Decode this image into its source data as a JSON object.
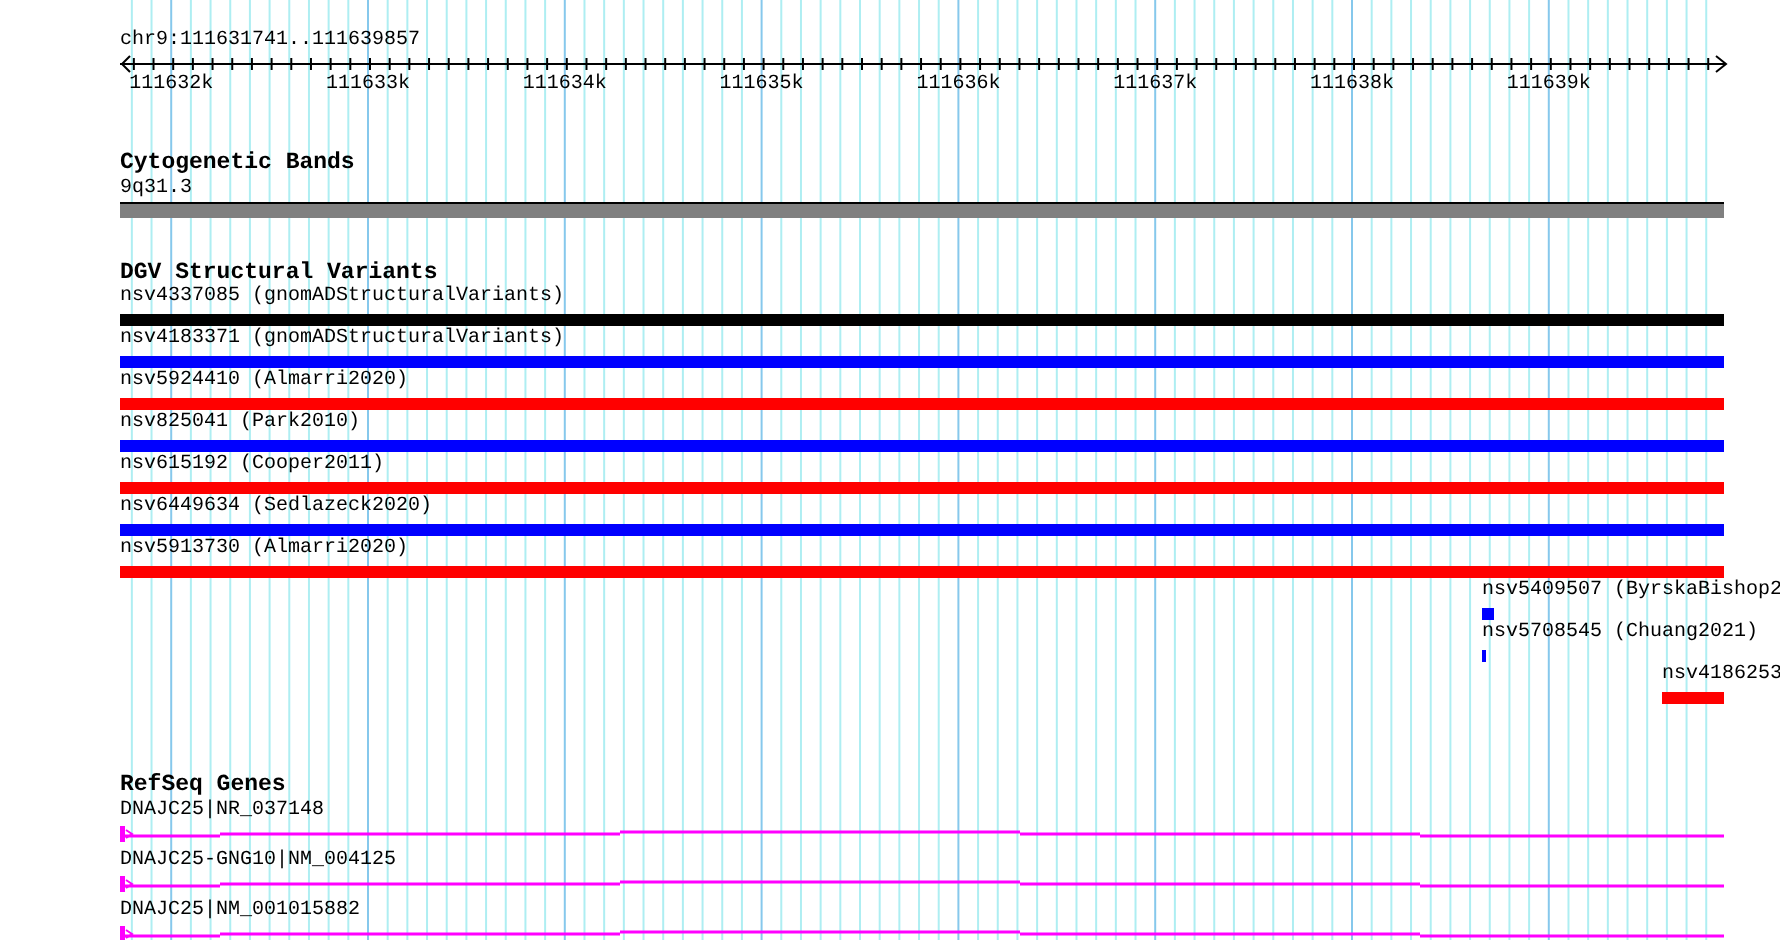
{
  "location": "chr9:111631741..111639857",
  "ruler": {
    "ticks": [
      "111632k",
      "111633k",
      "111634k",
      "111635k",
      "111636k",
      "111637k",
      "111638k",
      "111639k"
    ]
  },
  "tracks": [
    {
      "kind": "bands",
      "title": "Cytogenetic Bands",
      "features": [
        {
          "label": "9q31.3"
        }
      ]
    },
    {
      "kind": "variants",
      "title": "DGV Structural Variants",
      "features": [
        {
          "label": "nsv4337085 (gnomADStructuralVariants)",
          "color": "#000000"
        },
        {
          "label": "nsv4183371 (gnomADStructuralVariants)",
          "color": "#0000ff"
        },
        {
          "label": "nsv5924410 (Almarri2020)",
          "color": "#ff0000"
        },
        {
          "label": "nsv825041 (Park2010)",
          "color": "#0000ff"
        },
        {
          "label": "nsv615192 (Cooper2011)",
          "color": "#ff0000"
        },
        {
          "label": "nsv6449634 (Sedlazeck2020)",
          "color": "#0000ff"
        },
        {
          "label": "nsv5913730 (Almarri2020)",
          "color": "#ff0000"
        },
        {
          "label": "nsv5409507 (ByrskaBishop2",
          "color": "#0000ff"
        },
        {
          "label": "nsv5708545 (Chuang2021)",
          "color": "#0000ff"
        },
        {
          "label": "nsv4186253",
          "color": "#ff0000"
        }
      ]
    },
    {
      "kind": "genes",
      "title": "RefSeq Genes",
      "features": [
        {
          "label": "DNAJC25|NR_037148"
        },
        {
          "label": "DNAJC25-GNG10|NM_004125"
        },
        {
          "label": "DNAJC25|NM_001015882"
        }
      ]
    }
  ]
}
